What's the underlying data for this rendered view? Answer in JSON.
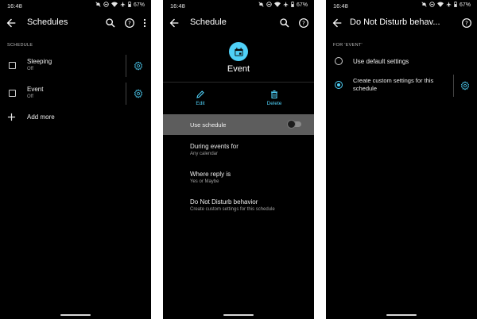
{
  "status": {
    "time": "16:48",
    "battery": "67%"
  },
  "screen1": {
    "title": "Schedules",
    "section_label": "SCHEDULE",
    "items": [
      {
        "label": "Sleeping",
        "status": "Off"
      },
      {
        "label": "Event",
        "status": "Off"
      }
    ],
    "add_more": "Add more"
  },
  "screen2": {
    "title": "Schedule",
    "hero_title": "Event",
    "edit_label": "Edit",
    "delete_label": "Delete",
    "use_schedule_label": "Use schedule",
    "use_schedule_on": false,
    "settings": [
      {
        "title": "During events for",
        "subtitle": "Any calendar"
      },
      {
        "title": "Where reply is",
        "subtitle": "Yes or Maybe"
      },
      {
        "title": "Do Not Disturb behavior",
        "subtitle": "Create custom settings for this schedule"
      }
    ]
  },
  "screen3": {
    "title": "Do Not Disturb behav...",
    "section_label": "FOR 'EVENT'",
    "options": [
      {
        "label": "Use default settings",
        "selected": false
      },
      {
        "label": "Create custom settings for this schedule",
        "selected": true
      }
    ]
  },
  "colors": {
    "accent": "#4fd0f7",
    "background": "#000000",
    "banner": "#5d5d5d"
  }
}
